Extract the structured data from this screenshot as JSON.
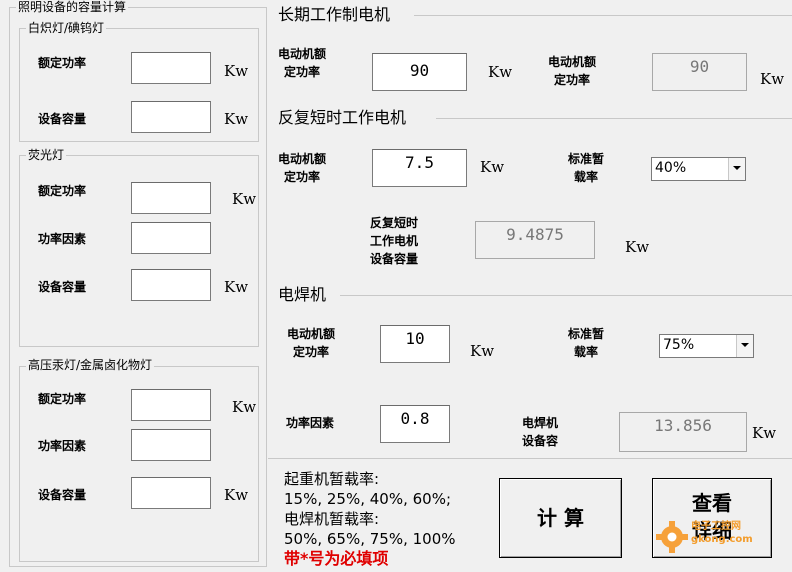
{
  "lighting": {
    "title": "照明设备的容量计算",
    "incandescent": {
      "title": "白炽灯/碘钨灯",
      "rated_power_label": "额定功率",
      "capacity_label": "设备容量",
      "rated_power_value": "",
      "capacity_value": "",
      "unit": "Kw"
    },
    "fluorescent": {
      "title": "荧光灯",
      "rated_power_label": "额定功率",
      "power_factor_label": "功率因素",
      "capacity_label": "设备容量",
      "rated_power_value": "",
      "power_factor_value": "",
      "capacity_value": "",
      "unit": "Kw"
    },
    "hid": {
      "title": "高压汞灯/金属卤化物灯",
      "rated_power_label": "额定功率",
      "power_factor_label": "功率因素",
      "capacity_label": "设备容量",
      "rated_power_value": "",
      "power_factor_value": "",
      "capacity_value": "",
      "unit": "Kw"
    }
  },
  "long_term": {
    "title": "长期工作制电机",
    "rated_power_label": "电动机额\n定功率",
    "rated_power_value": "90",
    "unit": "Kw",
    "motor_capacity_label": "电动机额\n定功率",
    "motor_capacity_value": "90",
    "unit2": "Kw"
  },
  "short_term": {
    "title": "反复短时工作电机",
    "rated_power_label": "电动机额\n定功率",
    "rated_power_value": "7.5",
    "unit": "Kw",
    "duty_label": "标准暂\n载率",
    "duty_value": "40%",
    "capacity_label": "反复短时\n工作电机\n设备容量",
    "capacity_value": "9.4875",
    "unit2": "Kw"
  },
  "welder": {
    "title": "电焊机",
    "rated_power_label": "电动机额\n定功率",
    "rated_power_value": "10",
    "unit": "Kw",
    "duty_label": "标准暂\n载率",
    "duty_value": "75%",
    "power_factor_label": "功率因素",
    "power_factor_value": "0.8",
    "capacity_label": "电焊机\n设备容",
    "capacity_value": "13.856",
    "unit2": "Kw"
  },
  "notes": {
    "line1": "起重机暂载率:",
    "line2": "15%, 25%, 40%, 60%;",
    "line3": "电焊机暂载率:",
    "line4": "50%, 65%, 75%, 100%",
    "required": "带*号为必填项"
  },
  "buttons": {
    "calculate": "计 算",
    "details": "查看\n详细"
  },
  "watermark": "电子工控网\ngkong.com"
}
